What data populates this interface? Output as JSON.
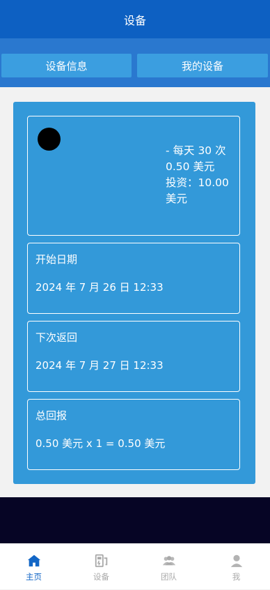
{
  "header": {
    "title": "设备"
  },
  "tabs": [
    {
      "label": "设备信息"
    },
    {
      "label": "我的设备"
    }
  ],
  "device_card": {
    "lines": [
      "- 每天 30 次",
      "0.50 美元",
      "投资：10.00",
      "美元"
    ]
  },
  "start_date": {
    "label": "开始日期",
    "value": "2024 年 7 月 26 日 12:33"
  },
  "next_return": {
    "label": "下次返回",
    "value": "2024 年 7 月 27 日 12:33"
  },
  "total_return": {
    "label": "总回报",
    "value": "0.50 美元 x 1 = 0.50 美元"
  },
  "bottom_nav": [
    {
      "label": "主页",
      "icon": "home-icon",
      "active": true
    },
    {
      "label": "设备",
      "icon": "device-icon",
      "active": false
    },
    {
      "label": "团队",
      "icon": "team-icon",
      "active": false
    },
    {
      "label": "我",
      "icon": "user-icon",
      "active": false
    }
  ],
  "colors": {
    "header": "#0d60c2",
    "panel": "#3399d9",
    "nav_active": "#1266c6"
  }
}
